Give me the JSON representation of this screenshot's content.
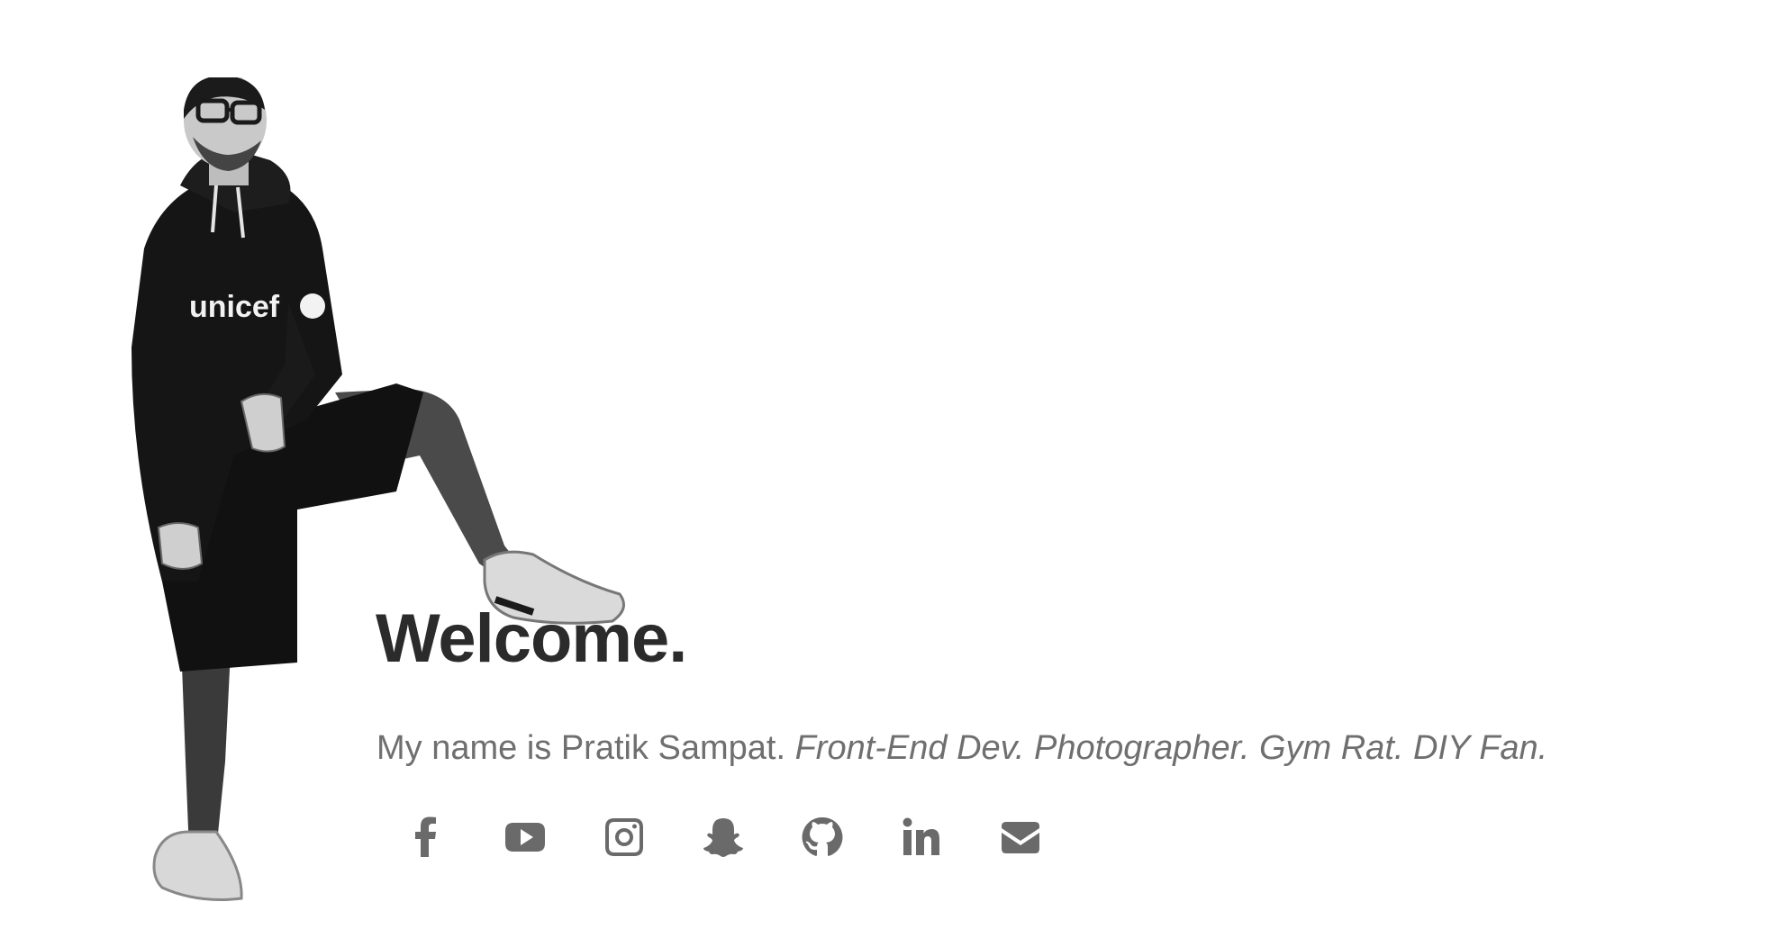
{
  "hero": {
    "heading": "Welcome.",
    "intro": "My name is Pratik Sampat. ",
    "roles": "Front-End Dev. Photographer. Gym Rat. DIY Fan.",
    "portrait_shirt_text": "unicef"
  },
  "social_links": [
    {
      "icon": "facebook-icon",
      "label": "Facebook"
    },
    {
      "icon": "youtube-icon",
      "label": "YouTube"
    },
    {
      "icon": "instagram-icon",
      "label": "Instagram"
    },
    {
      "icon": "snapchat-icon",
      "label": "Snapchat"
    },
    {
      "icon": "github-icon",
      "label": "GitHub"
    },
    {
      "icon": "linkedin-icon",
      "label": "LinkedIn"
    },
    {
      "icon": "email-icon",
      "label": "Email"
    }
  ],
  "colors": {
    "background": "#ffffff",
    "heading": "#2b2b2b",
    "body_text": "#6f6f6f",
    "icon": "#6a6a6a"
  }
}
